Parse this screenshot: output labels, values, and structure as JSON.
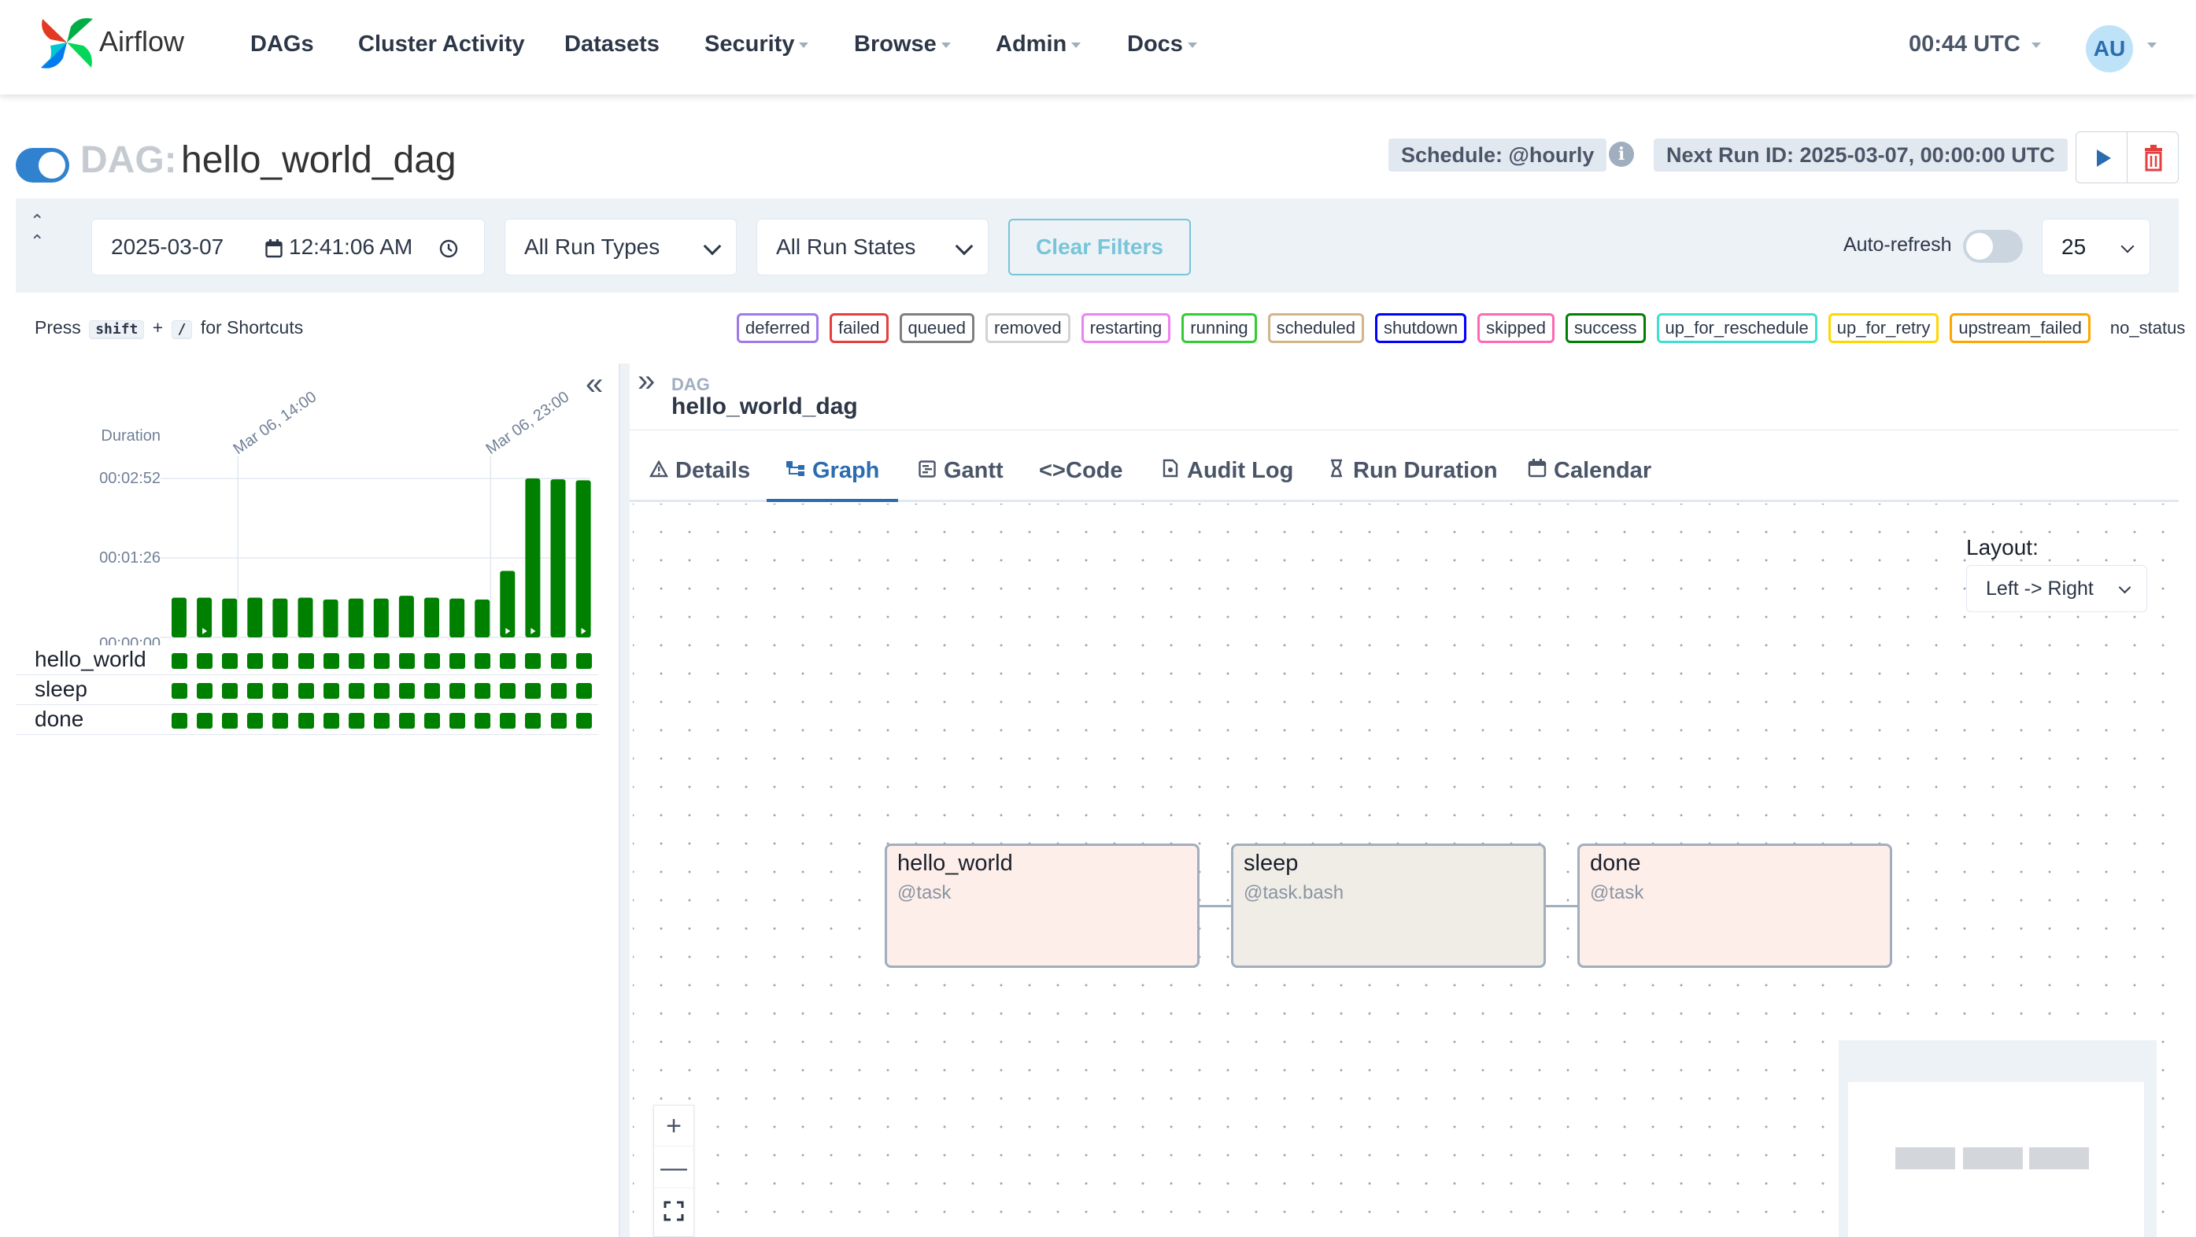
{
  "app": {
    "brand": "Airflow"
  },
  "nav": {
    "items": [
      {
        "label": "DAGs",
        "dropdown": false
      },
      {
        "label": "Cluster Activity",
        "dropdown": false
      },
      {
        "label": "Datasets",
        "dropdown": false
      },
      {
        "label": "Security",
        "dropdown": true
      },
      {
        "label": "Browse",
        "dropdown": true
      },
      {
        "label": "Admin",
        "dropdown": true
      },
      {
        "label": "Docs",
        "dropdown": true
      }
    ],
    "clock": "00:44 UTC",
    "avatar": "AU"
  },
  "dag": {
    "prefix": "DAG:",
    "name": "hello_world_dag",
    "paused": false,
    "schedule": "Schedule: @hourly",
    "next_run": "Next Run ID: 2025-03-07, 00:00:00 UTC"
  },
  "filters": {
    "date": "2025-03-07",
    "time": "12:41:06 AM",
    "run_types": "All Run Types",
    "run_states": "All Run States",
    "clear": "Clear Filters",
    "auto_refresh_label": "Auto-refresh",
    "auto_refresh": false,
    "page_size": "25"
  },
  "shortcut": {
    "press": "Press",
    "key1": "shift",
    "plus": "+",
    "key2": "/",
    "suffix": "for Shortcuts"
  },
  "statuses": [
    {
      "label": "deferred",
      "color": "#9f7aea"
    },
    {
      "label": "failed",
      "color": "#e53e3e"
    },
    {
      "label": "queued",
      "color": "#808080"
    },
    {
      "label": "removed",
      "color": "#d3d3d3"
    },
    {
      "label": "restarting",
      "color": "#ee82ee"
    },
    {
      "label": "running",
      "color": "#32cd32"
    },
    {
      "label": "scheduled",
      "color": "#d2b48c"
    },
    {
      "label": "shutdown",
      "color": "#0000ff"
    },
    {
      "label": "skipped",
      "color": "#ff69b4"
    },
    {
      "label": "success",
      "color": "#008000"
    },
    {
      "label": "up_for_reschedule",
      "color": "#40e0d0"
    },
    {
      "label": "up_for_retry",
      "color": "#ffd700"
    },
    {
      "label": "upstream_failed",
      "color": "#ffa500"
    },
    {
      "label": "no_status",
      "color": "transparent"
    }
  ],
  "grid": {
    "tasks": [
      "hello_world",
      "sleep",
      "done"
    ],
    "run_count": 17,
    "task_state": "success",
    "success_color": "#008000"
  },
  "chart_data": {
    "type": "bar",
    "ylabel": "Duration",
    "y_ticks": [
      "00:00:00",
      "00:01:26",
      "00:02:52"
    ],
    "x_ticks": [
      "Mar 06, 14:00",
      "Mar 06, 23:00"
    ],
    "unit": "seconds",
    "ylim": [
      0,
      172
    ],
    "values": [
      43,
      43,
      42,
      43,
      42,
      43,
      41,
      42,
      42,
      45,
      43,
      42,
      41,
      72,
      172,
      171,
      170
    ],
    "manual_runs": [
      1,
      13,
      14,
      16
    ],
    "color": "#008000"
  },
  "panel": {
    "crumb_label": "DAG",
    "crumb_name": "hello_world_dag",
    "tabs": [
      {
        "label": "Details",
        "icon": "warning-icon"
      },
      {
        "label": "Graph",
        "icon": "graph-icon",
        "active": true
      },
      {
        "label": "Gantt",
        "icon": "gantt-icon"
      },
      {
        "label": "Code",
        "icon": "code-icon"
      },
      {
        "label": "Audit Log",
        "icon": "file-icon"
      },
      {
        "label": "Run Duration",
        "icon": "hourglass-icon"
      },
      {
        "label": "Calendar",
        "icon": "calendar-icon"
      }
    ],
    "layout_label": "Layout:",
    "layout_value": "Left -> Right"
  },
  "graph": {
    "nodes": [
      {
        "label": "hello_world",
        "sub": "@task",
        "fill": "#fdeee9"
      },
      {
        "label": "sleep",
        "sub": "@task.bash",
        "fill": "#efede6"
      },
      {
        "label": "done",
        "sub": "@task",
        "fill": "#fdeee9"
      }
    ]
  }
}
